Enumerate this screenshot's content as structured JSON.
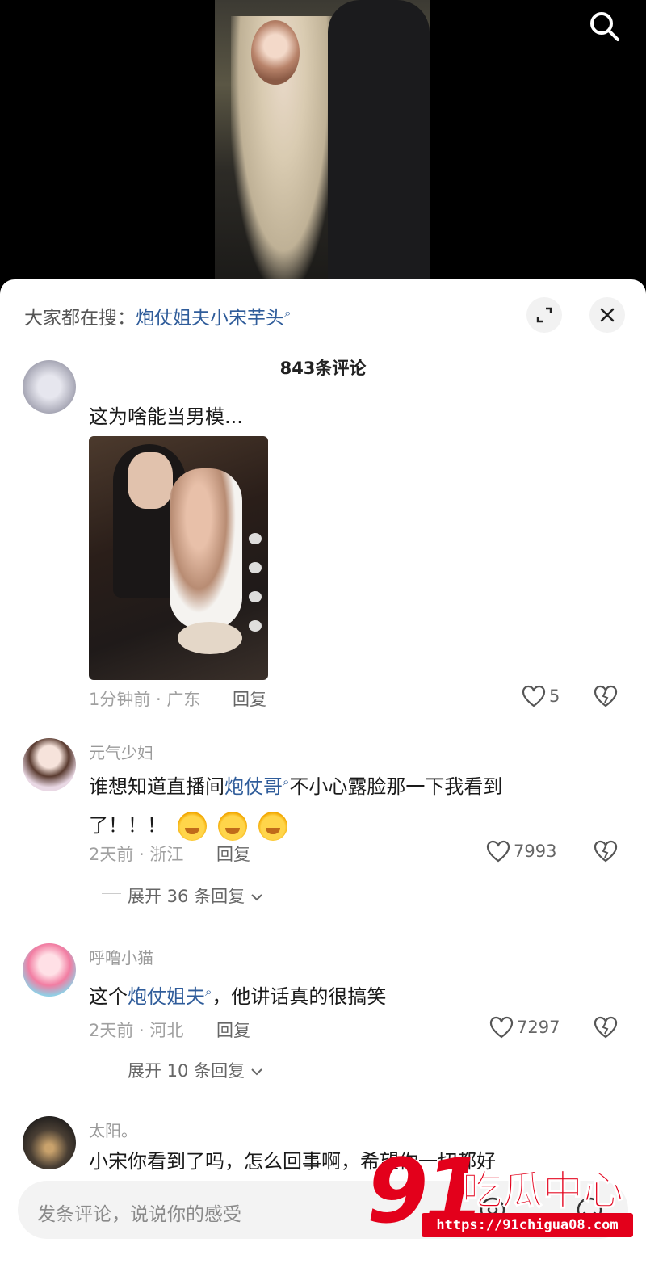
{
  "hot_search": {
    "prefix": "大家都在搜：",
    "keyword": "炮仗姐夫小宋芋头"
  },
  "comment_count": "843条评论",
  "comments": [
    {
      "username": "",
      "text": "这为啥能当男模...",
      "time_loc": "1分钟前 · 广东",
      "reply_label": "回复",
      "likes": "5",
      "has_image": true
    },
    {
      "username": "元气少妇",
      "text_before": "谁想知道直播间",
      "keyword": "炮仗哥",
      "text_after": "不小心露脸那一下我看到了！！！",
      "time_loc": "2天前 · 浙江",
      "reply_label": "回复",
      "likes": "7993",
      "expand": "展开 36 条回复"
    },
    {
      "username": "呼噜小猫",
      "text_before": "这个",
      "keyword": "炮仗姐夫",
      "text_after": "，他讲话真的很搞笑",
      "time_loc": "2天前 · 河北",
      "reply_label": "回复",
      "likes": "7297",
      "expand": "展开 10 条回复"
    },
    {
      "username": "太阳。",
      "text": "小宋你看到了吗，怎么回事啊，希望你一切都好"
    }
  ],
  "input": {
    "placeholder": "发条评论，说说你的感受"
  },
  "watermark": {
    "number": "91",
    "name": "吃瓜中心",
    "url": "https://91chigua08.com"
  },
  "colors": {
    "keyword": "#2f5c9a",
    "watermark": "#e3001b"
  }
}
